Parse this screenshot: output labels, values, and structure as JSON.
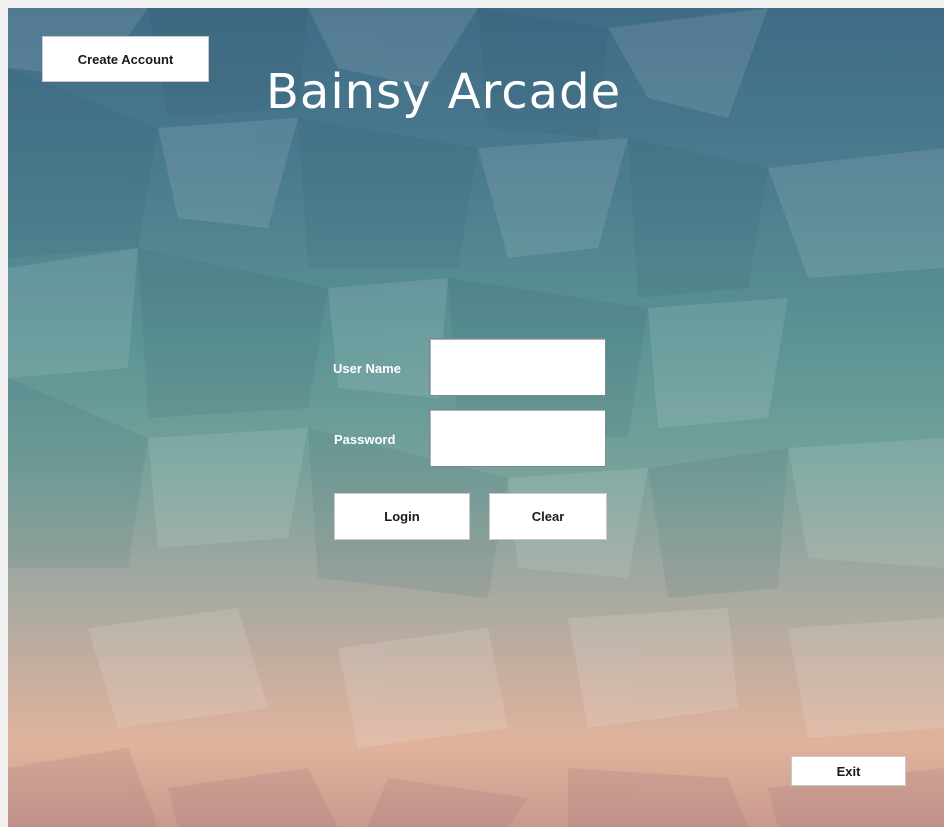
{
  "window": {
    "title": "Bainsy Arcade"
  },
  "header": {
    "create_account_label": "Create Account",
    "title": "Bainsy Arcade"
  },
  "login_form": {
    "username_label": "User Name",
    "username_value": "",
    "password_label": "Password",
    "password_value": "",
    "login_label": "Login",
    "clear_label": "Clear"
  },
  "footer": {
    "exit_label": "Exit"
  },
  "colors": {
    "background_top": "#3f6b86",
    "background_mid": "#5a9394",
    "background_bottom": "#e0b39c",
    "button_bg": "#ffffff",
    "text_light": "#ffffff"
  }
}
